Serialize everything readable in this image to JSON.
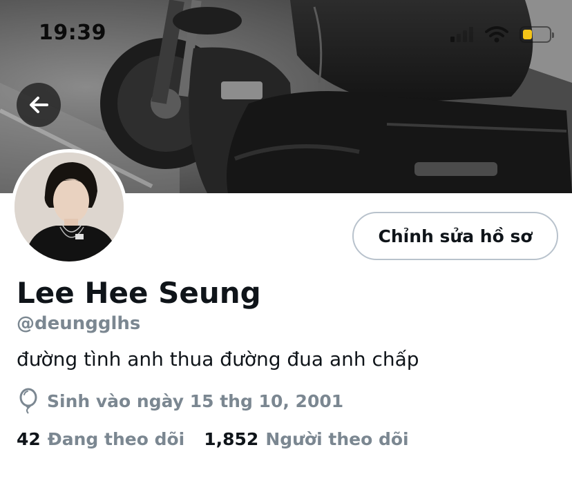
{
  "status_bar": {
    "time": "19:39",
    "battery_level": 0.35,
    "battery_color": "#f5c518"
  },
  "header": {
    "back_icon": "arrow-left-icon"
  },
  "profile": {
    "edit_button_label": "Chỉnh sửa hồ sơ",
    "display_name": "Lee Hee Seung",
    "handle": "@deungglhs",
    "bio": "đường tình anh thua đường đua anh chấp",
    "birthday_icon": "balloon-icon",
    "birthday": "Sinh vào ngày 15 thg 10, 2001",
    "following_count": "42",
    "following_label": "Đang theo dõi",
    "followers_count": "1,852",
    "followers_label": "Người theo dõi"
  },
  "colors": {
    "primary_text": "#0f1419",
    "secondary_text": "#7b8791",
    "button_border": "#b8c2cc"
  }
}
